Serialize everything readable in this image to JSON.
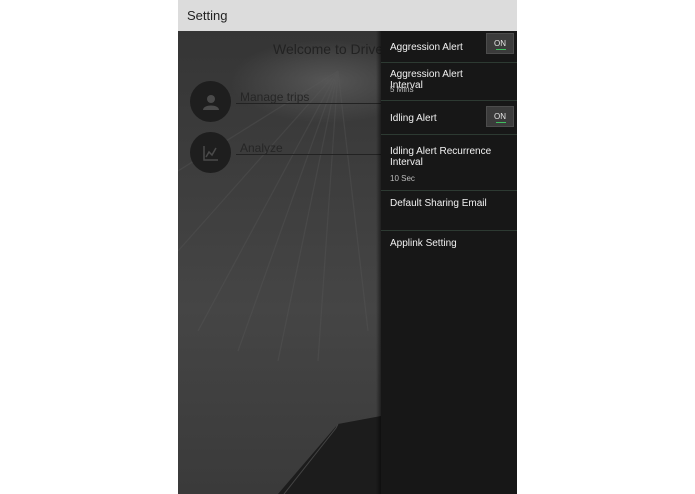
{
  "appbar": {
    "title": "Setting"
  },
  "home": {
    "welcome": "Welcome to Drive",
    "menu": [
      {
        "label": "Manage trips",
        "icon": "person-icon"
      },
      {
        "label": "Analyze",
        "icon": "chart-icon"
      }
    ]
  },
  "drawer": {
    "aggression_alert": {
      "label": "Aggression Alert",
      "toggle": "ON"
    },
    "aggression_interval": {
      "label": "Aggression Alert Interval",
      "value": "5 Mins"
    },
    "idling_alert": {
      "label": "Idling Alert",
      "toggle": "ON"
    },
    "idling_interval": {
      "label": "Idling Alert Recurrence Interval",
      "value": "10 Sec"
    },
    "sharing_email": {
      "label": "Default Sharing Email"
    },
    "applink": {
      "label": "Applink Setting"
    }
  },
  "colors": {
    "drawer_bg": "#171717",
    "appbar_bg": "#dcdcdc",
    "toggle_accent": "#3fbf5f"
  }
}
